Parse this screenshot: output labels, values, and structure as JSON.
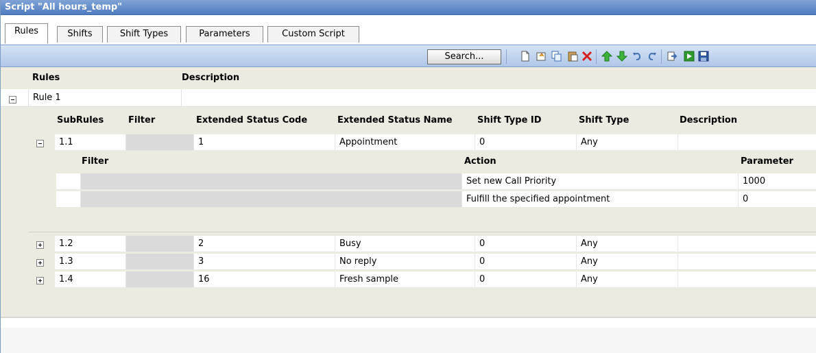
{
  "window": {
    "title": "Script \"All hours_temp\""
  },
  "tabs": [
    {
      "label": "Rules"
    },
    {
      "label": "Shifts"
    },
    {
      "label": "Shift Types"
    },
    {
      "label": "Parameters"
    },
    {
      "label": "Custom Script"
    }
  ],
  "toolbar": {
    "search_label": "Search...",
    "icons": [
      "new-document-icon",
      "open-icon",
      "copy-icon",
      "paste-icon",
      "delete-icon",
      "move-up-icon",
      "move-down-icon",
      "undo-icon",
      "redo-icon",
      "export-icon",
      "run-icon",
      "save-icon"
    ]
  },
  "rules_table": {
    "headers": {
      "rules": "Rules",
      "description": "Description"
    },
    "rule": {
      "name": "Rule 1",
      "description": ""
    },
    "subrule_headers": {
      "subrules": "SubRules",
      "filter": "Filter",
      "ext_code": "Extended Status Code",
      "ext_name": "Extended Status Name",
      "shift_type_id": "Shift Type ID",
      "shift_type": "Shift Type",
      "description": "Description"
    },
    "subrules": [
      {
        "id": "1.1",
        "filter": "",
        "code": "1",
        "name": "Appointment",
        "shift_type_id": "0",
        "shift_type": "Any",
        "description": ""
      },
      {
        "id": "1.2",
        "filter": "",
        "code": "2",
        "name": "Busy",
        "shift_type_id": "0",
        "shift_type": "Any",
        "description": ""
      },
      {
        "id": "1.3",
        "filter": "",
        "code": "3",
        "name": "No reply",
        "shift_type_id": "0",
        "shift_type": "Any",
        "description": ""
      },
      {
        "id": "1.4",
        "filter": "",
        "code": "16",
        "name": "Fresh sample",
        "shift_type_id": "0",
        "shift_type": "Any",
        "description": ""
      }
    ],
    "action_headers": {
      "filter": "Filter",
      "action": "Action",
      "parameter": "Parameter"
    },
    "actions": [
      {
        "filter": "",
        "action": "Set new Call Priority",
        "parameter": "1000"
      },
      {
        "filter": "",
        "action": "Fulfill the specified appointment",
        "parameter": "0"
      }
    ]
  }
}
